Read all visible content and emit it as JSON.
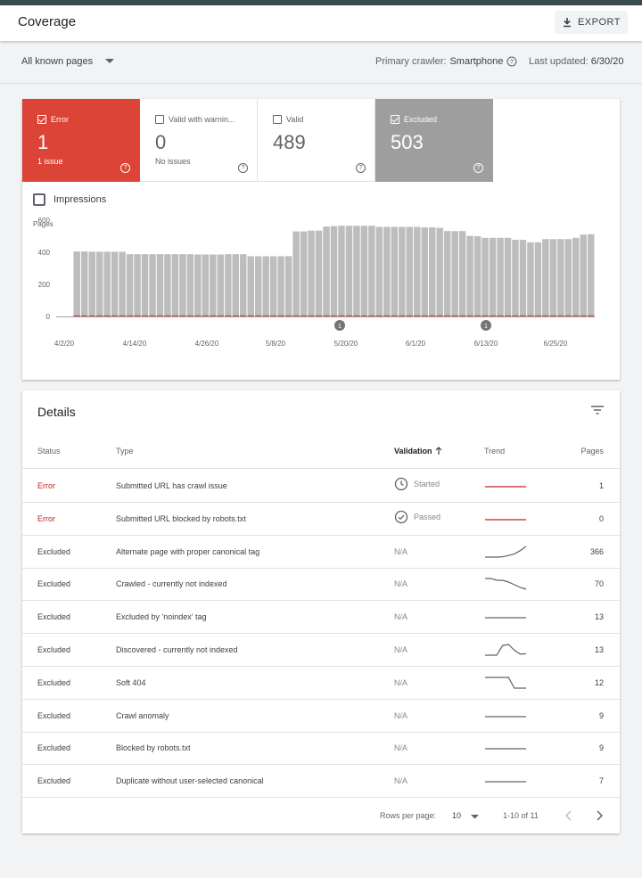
{
  "app": {
    "title": "Coverage",
    "export_label": "EXPORT"
  },
  "filter": {
    "property_selected": "All known pages",
    "crawler_label": "Primary crawler:",
    "crawler_value": "Smartphone",
    "updated_label": "Last updated:",
    "updated_value": "6/30/20"
  },
  "tiles": [
    {
      "label": "Error",
      "count": "1",
      "sub": "1 issue",
      "checked": true,
      "color": "#db4437"
    },
    {
      "label": "Valid with warnin...",
      "count": "0",
      "sub": "No issues",
      "checked": false
    },
    {
      "label": "Valid",
      "count": "489",
      "sub": "",
      "checked": false
    },
    {
      "label": "Excluded",
      "count": "503",
      "sub": "",
      "checked": true,
      "color": "#9e9e9e"
    }
  ],
  "impressions_label": "Impressions",
  "chart_data": {
    "type": "bar",
    "ylabel": "Pages",
    "ylim": [
      0,
      600
    ],
    "yticks": [
      "600",
      "400",
      "200",
      "0"
    ],
    "xticks": [
      "4/2/20",
      "4/14/20",
      "4/26/20",
      "5/8/20",
      "5/20/20",
      "6/1/20",
      "6/13/20",
      "6/25/20"
    ],
    "series": [
      {
        "color": "#bdbdbd",
        "values": [
          405,
          405,
          403,
          403,
          403,
          403,
          403,
          388,
          388,
          388,
          388,
          388,
          388,
          388,
          388,
          388,
          386,
          386,
          386,
          386,
          388,
          388,
          388,
          375,
          375,
          375,
          375,
          375,
          376,
          530,
          530,
          535,
          535,
          560,
          563,
          565,
          565,
          565,
          565,
          565,
          558,
          558,
          558,
          558,
          558,
          558,
          555,
          555,
          552,
          532,
          532,
          532,
          502,
          500,
          490,
          490,
          490,
          490,
          478,
          478,
          462,
          462,
          482,
          482,
          482,
          482,
          490,
          510,
          512
        ]
      },
      {
        "color": "#db4437",
        "values": [
          1,
          1,
          1,
          1,
          1,
          1,
          1,
          1,
          1,
          1,
          1,
          1,
          1,
          1,
          1,
          1,
          1,
          1,
          1,
          1,
          1,
          1,
          1,
          1,
          1,
          1,
          1,
          1,
          1,
          1,
          1,
          1,
          1,
          1,
          1,
          1,
          1,
          1,
          1,
          1,
          1,
          1,
          1,
          1,
          1,
          1,
          1,
          1,
          1,
          1,
          1,
          1,
          1,
          1,
          1,
          1,
          1,
          1,
          1,
          1,
          1,
          1,
          1,
          1,
          1,
          1,
          1,
          1,
          1
        ]
      }
    ],
    "annotations": [
      "1",
      "1"
    ]
  },
  "details": {
    "title": "Details",
    "columns": {
      "status": "Status",
      "type": "Type",
      "validation": "Validation",
      "trend": "Trend",
      "pages": "Pages"
    },
    "rows": [
      {
        "status": "Error",
        "type": "Submitted URL has crawl issue",
        "validation": "Started",
        "val_icon": "clock-icon",
        "pages": "1",
        "trend": [
          1,
          1,
          1,
          1,
          1,
          1,
          1,
          1
        ],
        "trend_color": "#c5221f"
      },
      {
        "status": "Error",
        "type": "Submitted URL blocked by robots.txt",
        "validation": "Passed",
        "val_icon": "check-circle-icon",
        "pages": "0",
        "trend": [
          0,
          0,
          0,
          0,
          0,
          0,
          0,
          0
        ],
        "trend_color": "#c5221f"
      },
      {
        "status": "Excluded",
        "type": "Alternate page with proper canonical tag",
        "validation": "N/A",
        "pages": "366",
        "trend": [
          300,
          300,
          300,
          302,
          310,
          320,
          340,
          366
        ],
        "trend_color": "#5f6368"
      },
      {
        "status": "Excluded",
        "type": "Crawled - currently not indexed",
        "validation": "N/A",
        "pages": "70",
        "trend": [
          82,
          82,
          80,
          80,
          78,
          75,
          72,
          70
        ],
        "trend_color": "#5f6368"
      },
      {
        "status": "Excluded",
        "type": "Excluded by 'noindex' tag",
        "validation": "N/A",
        "pages": "13",
        "trend": [
          13,
          13,
          13,
          13,
          13,
          13,
          13,
          13
        ],
        "trend_color": "#5f6368"
      },
      {
        "status": "Excluded",
        "type": "Discovered - currently not indexed",
        "validation": "N/A",
        "pages": "13",
        "trend": [
          10,
          10,
          10,
          30,
          32,
          20,
          12,
          13
        ],
        "trend_color": "#5f6368"
      },
      {
        "status": "Excluded",
        "type": "Soft 404",
        "validation": "N/A",
        "pages": "12",
        "trend": [
          13,
          13,
          13,
          13,
          13,
          12,
          12,
          12
        ],
        "trend_color": "#5f6368"
      },
      {
        "status": "Excluded",
        "type": "Crawl anomaly",
        "validation": "N/A",
        "pages": "9",
        "trend": [
          9,
          9,
          9,
          9,
          9,
          9,
          9,
          9
        ],
        "trend_color": "#5f6368"
      },
      {
        "status": "Excluded",
        "type": "Blocked by robots.txt",
        "validation": "N/A",
        "pages": "9",
        "trend": [
          9,
          9,
          9,
          9,
          9,
          9,
          9,
          9
        ],
        "trend_color": "#5f6368"
      },
      {
        "status": "Excluded",
        "type": "Duplicate without user-selected canonical",
        "validation": "N/A",
        "pages": "7",
        "trend": [
          7,
          7,
          7,
          7,
          7,
          7,
          7,
          7
        ],
        "trend_color": "#5f6368"
      }
    ],
    "pager": {
      "rows_label": "Rows per page:",
      "rows_value": "10",
      "range": "1-10 of 11"
    }
  }
}
